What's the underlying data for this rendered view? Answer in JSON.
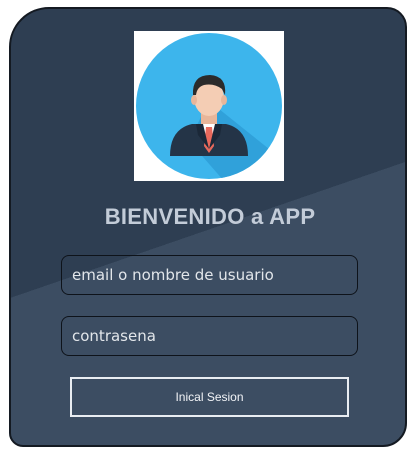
{
  "header": {
    "title": "BIENVENIDO a APP"
  },
  "avatar": {
    "icon": "user-avatar-businessman-icon",
    "circle_color": "#3db5ec"
  },
  "form": {
    "username_placeholder": "email o nombre de usuario",
    "password_placeholder": "contrasena",
    "submit_label": "Inical Sesion"
  },
  "colors": {
    "card_dark": "#2e3e52",
    "card_light": "#3c4d62",
    "title_text": "#c3ccd8"
  }
}
